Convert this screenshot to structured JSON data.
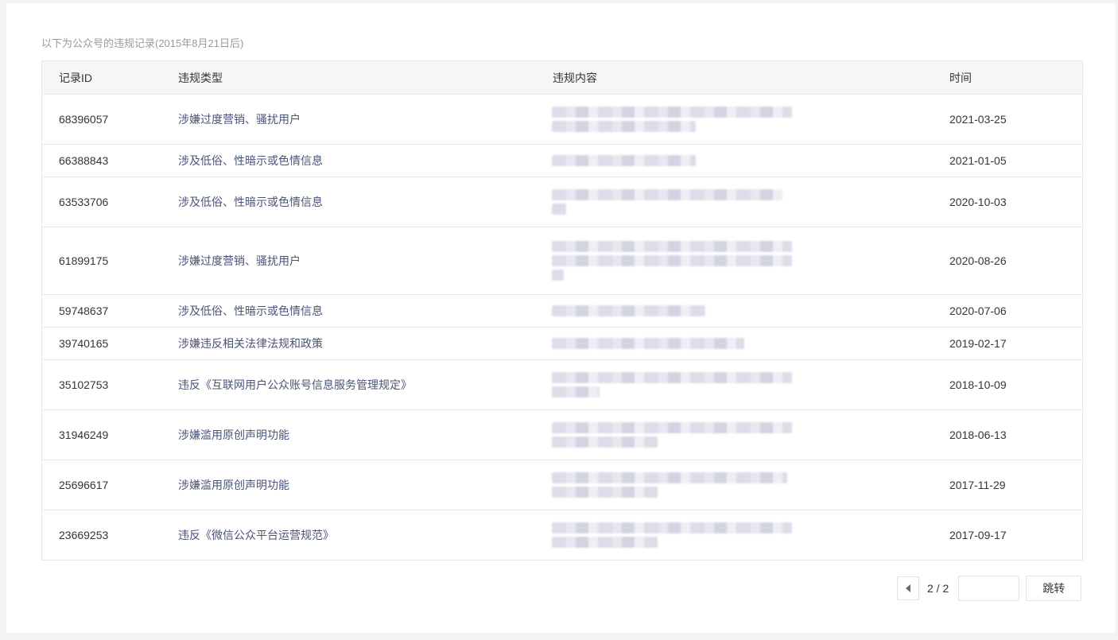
{
  "caption": "以下为公众号的违规记录(2015年8月21日后)",
  "table": {
    "headers": [
      "记录ID",
      "违规类型",
      "违规内容",
      "时间"
    ],
    "rows": [
      {
        "id": "68396057",
        "type": "涉嫌过度营销、骚扰用户",
        "date": "2021-03-25",
        "lines": 2
      },
      {
        "id": "66388843",
        "type": "涉及低俗、性暗示或色情信息",
        "date": "2021-01-05",
        "lines": 1
      },
      {
        "id": "63533706",
        "type": "涉及低俗、性暗示或色情信息",
        "date": "2020-10-03",
        "lines": 2
      },
      {
        "id": "61899175",
        "type": "涉嫌过度营销、骚扰用户",
        "date": "2020-08-26",
        "lines": 3
      },
      {
        "id": "59748637",
        "type": "涉及低俗、性暗示或色情信息",
        "date": "2020-07-06",
        "lines": 1
      },
      {
        "id": "39740165",
        "type": "涉嫌违反相关法律法规和政策",
        "date": "2019-02-17",
        "lines": 1
      },
      {
        "id": "35102753",
        "type": "违反《互联网用户公众账号信息服务管理规定》",
        "date": "2018-10-09",
        "lines": 2
      },
      {
        "id": "31946249",
        "type": "涉嫌滥用原创声明功能",
        "date": "2018-06-13",
        "lines": 2
      },
      {
        "id": "25696617",
        "type": "涉嫌滥用原创声明功能",
        "date": "2017-11-29",
        "lines": 2
      },
      {
        "id": "23669253",
        "type": "违反《微信公众平台运营规范》",
        "date": "2017-09-17",
        "lines": 2
      }
    ]
  },
  "pager": {
    "prev_icon": "triangle-left-icon",
    "page_text": "2 / 2",
    "input_value": "",
    "jump_label": "跳转"
  }
}
